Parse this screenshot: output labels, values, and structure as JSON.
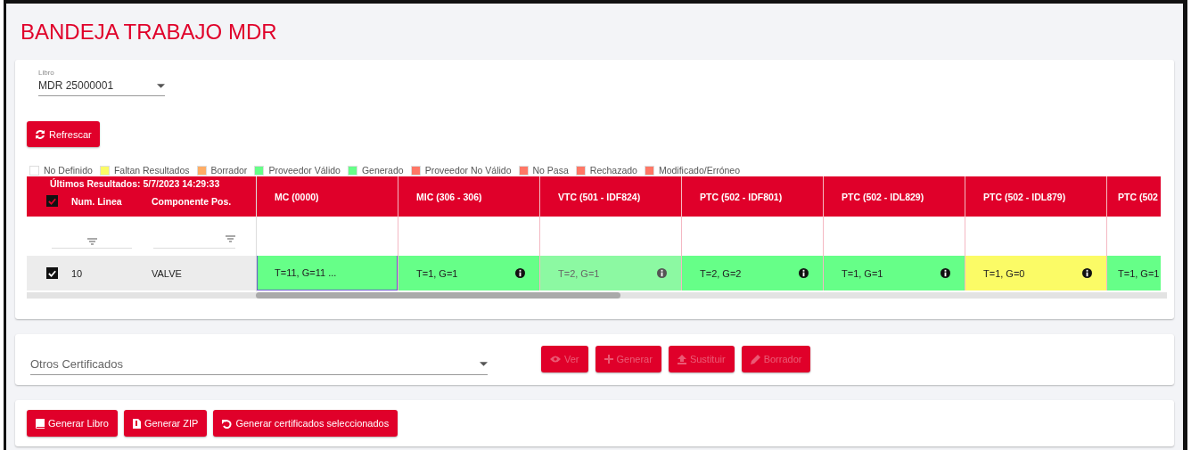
{
  "title": "BANDEJA TRABAJO MDR",
  "libro": {
    "label": "Libro",
    "value": "MDR 25000001"
  },
  "refresh_button": "Refrescar",
  "legend": [
    {
      "label": "No Definido",
      "color": "#ffffff"
    },
    {
      "label": "Faltan Resultados",
      "color": "#fbfb66"
    },
    {
      "label": "Borrador",
      "color": "#ffad66"
    },
    {
      "label": "Proveedor Válido",
      "color": "#66ff88"
    },
    {
      "label": "Generado",
      "color": "#66ff88"
    },
    {
      "label": "Proveedor No Válido",
      "color": "#ff7766"
    },
    {
      "label": "No Pasa",
      "color": "#ff7766"
    },
    {
      "label": "Rechazado",
      "color": "#ff7766"
    },
    {
      "label": "Modificado/Erróneo",
      "color": "#ff7766"
    }
  ],
  "table": {
    "last_results": "Últimos Resultados: 5/7/2023 14:29:33",
    "all_checked": true,
    "frozen_columns": [
      "Num. Linea",
      "Componente Pos."
    ],
    "columns": [
      "MC (0000)",
      "MIC (306 - 306)",
      "VTC (501 - IDF824)",
      "PTC (502 - IDF801)",
      "PTC (502 - IDL829)",
      "PTC (502 - IDL879)",
      "PTC (502"
    ],
    "rows": [
      {
        "checked": true,
        "line": "10",
        "component": "VALVE",
        "cells": [
          {
            "text": "T=11, G=11 ...",
            "color": "#66ff88",
            "info": false,
            "muted": false,
            "selected": true
          },
          {
            "text": "T=1, G=1",
            "color": "#66ff88",
            "info": true,
            "muted": false,
            "selected": false
          },
          {
            "text": "T=2, G=1",
            "color": "#8cf9a2",
            "info": true,
            "muted": true,
            "selected": false
          },
          {
            "text": "T=2, G=2",
            "color": "#66ff88",
            "info": true,
            "muted": false,
            "selected": false
          },
          {
            "text": "T=1, G=1",
            "color": "#66ff88",
            "info": true,
            "muted": false,
            "selected": false
          },
          {
            "text": "T=1, G=0",
            "color": "#fbfb66",
            "info": true,
            "muted": false,
            "selected": false
          },
          {
            "text": "T=1, G=1",
            "color": "#66ff88",
            "info": false,
            "muted": false,
            "selected": false
          }
        ]
      }
    ]
  },
  "otros": {
    "placeholder": "Otros Certificados"
  },
  "cert_buttons": [
    {
      "kind": "eye",
      "label": "Ver",
      "disabled": true
    },
    {
      "kind": "plus",
      "label": "Generar",
      "disabled": true
    },
    {
      "kind": "upload",
      "label": "Sustituir",
      "disabled": true
    },
    {
      "kind": "pen",
      "label": "Borrador",
      "disabled": true
    }
  ],
  "actions": [
    {
      "kind": "book",
      "label": "Generar Libro"
    },
    {
      "kind": "zip",
      "label": "Generar ZIP"
    },
    {
      "kind": "undo",
      "label": "Generar certificados seleccionados"
    }
  ]
}
